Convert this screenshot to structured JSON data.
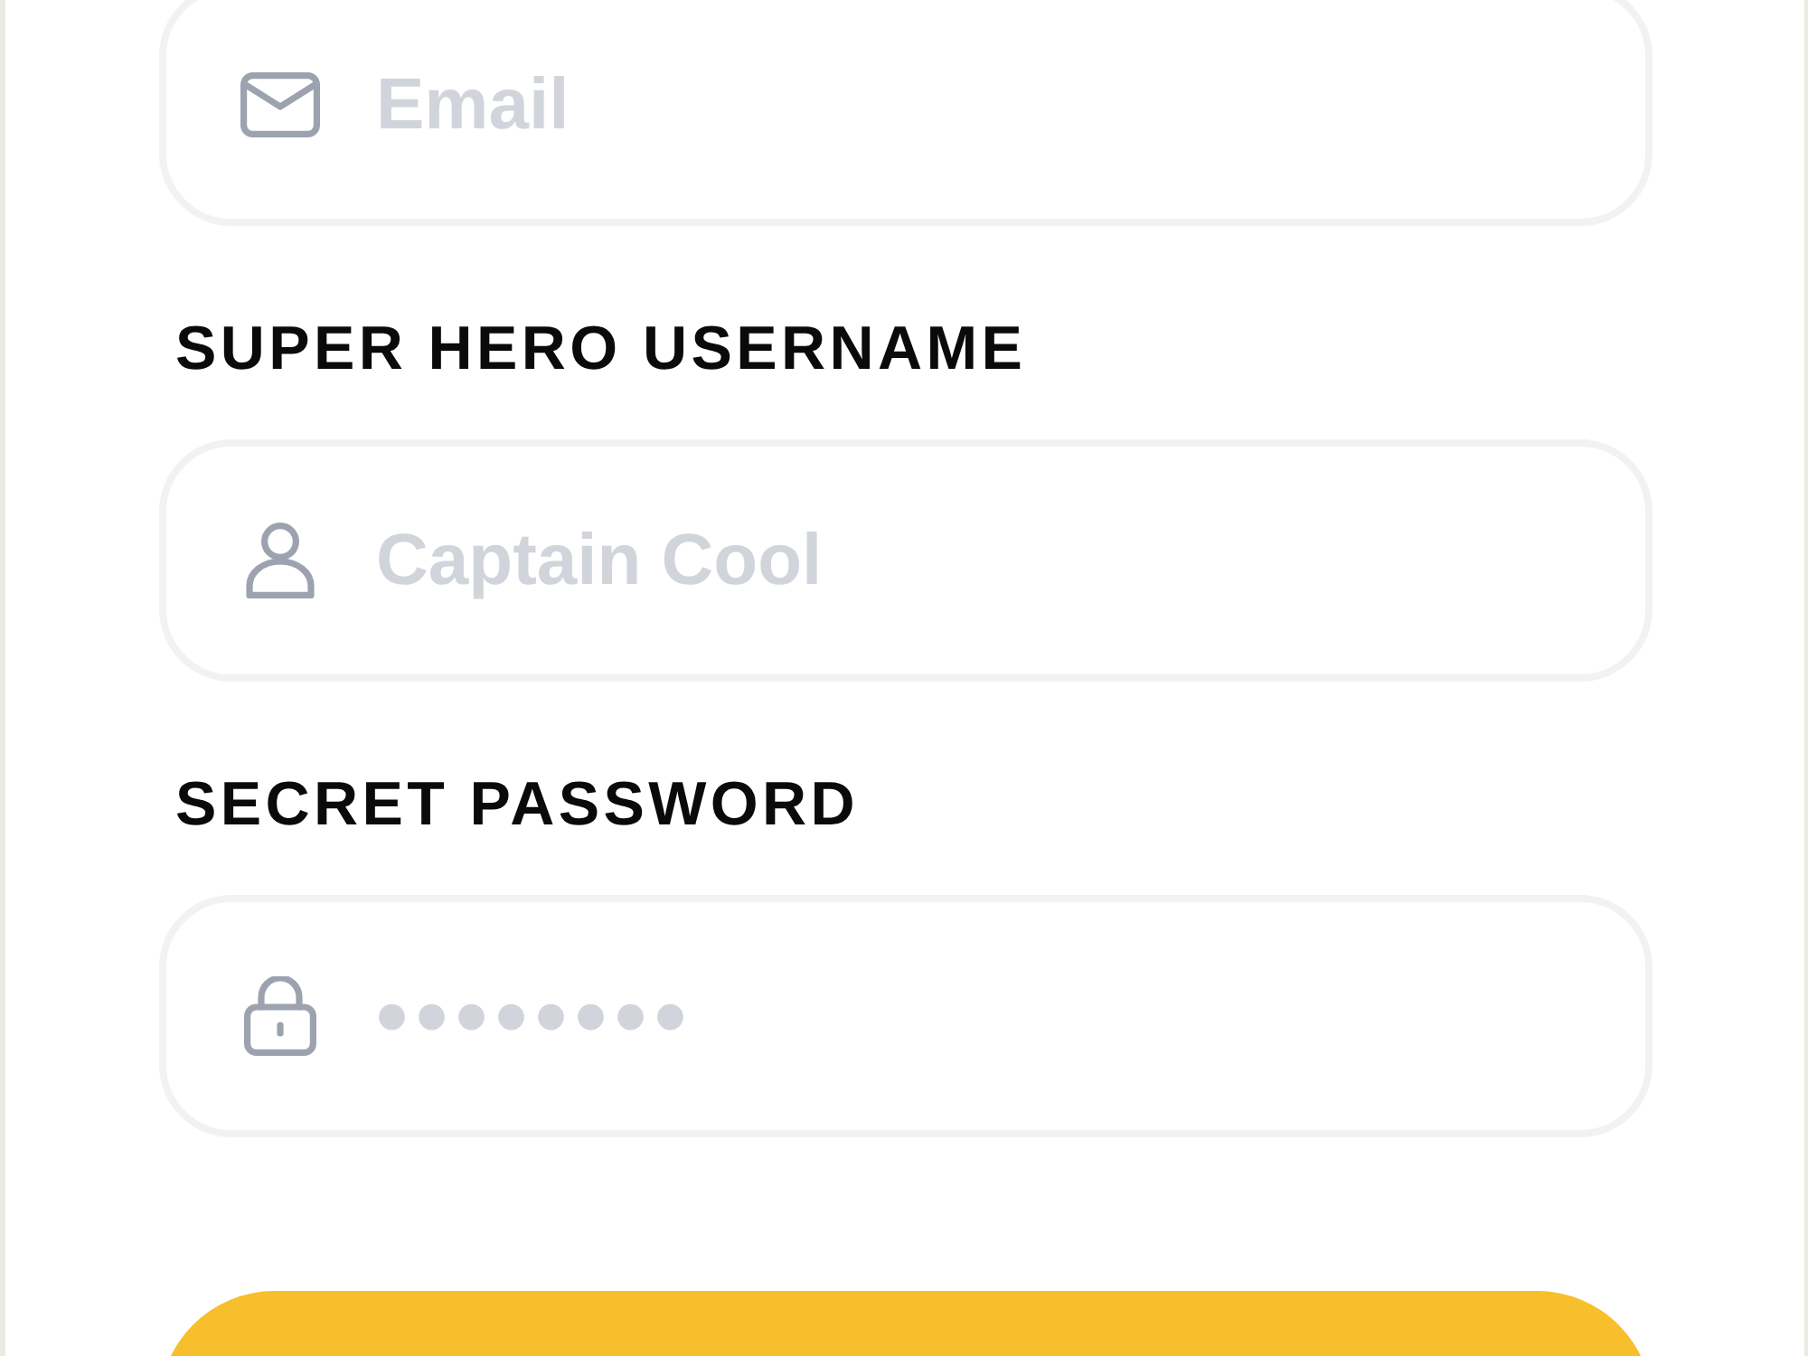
{
  "fields": [
    {
      "kind": "email",
      "placeholder": "Email"
    },
    {
      "kind": "text",
      "label": "SUPER HERO USERNAME",
      "placeholder": "Captain Cool"
    },
    {
      "kind": "password",
      "label": "SECRET PASSWORD",
      "placeholder": "••••••••"
    }
  ]
}
